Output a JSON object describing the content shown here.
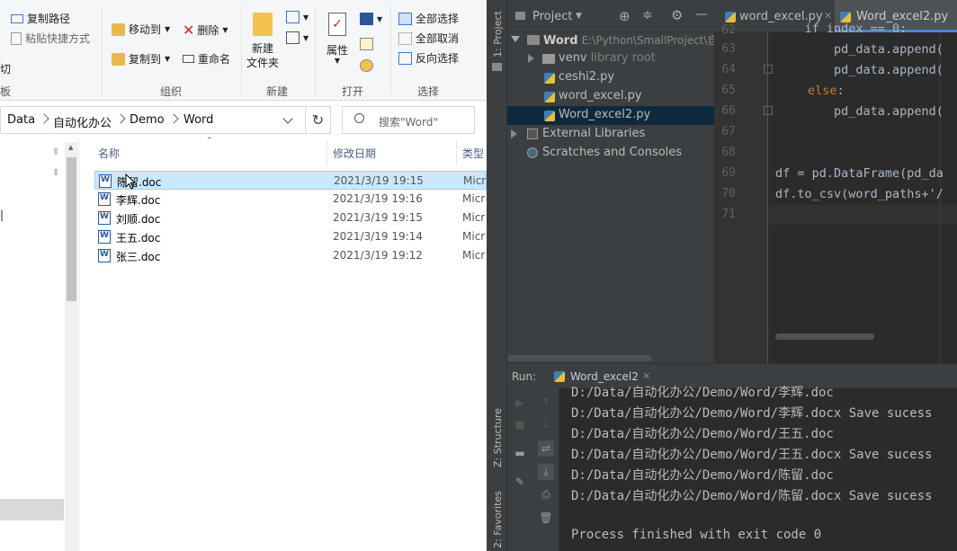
{
  "explorer": {
    "ribbon": {
      "copy_path": "复制路径",
      "paste_shortcut": "粘贴快捷方式",
      "cut_partial": "切",
      "clip_partial": "板",
      "move_to": "移动到",
      "copy_to": "复制到",
      "delete": "删除",
      "rename": "重命名",
      "new_folder": "新建\n文件夹",
      "new_folder_l1": "新建",
      "new_folder_l2": "文件夹",
      "properties": "属性",
      "select_all": "全部选择",
      "select_none": "全部取消",
      "invert_selection": "反向选择",
      "group_organize": "组织",
      "group_new": "新建",
      "group_open": "打开",
      "group_select": "选择"
    },
    "breadcrumb": [
      "Data",
      "自动化办公",
      "Demo",
      "Word"
    ],
    "search_placeholder": "搜索\"Word\"",
    "columns": {
      "name": "名称",
      "date": "修改日期",
      "type": "类型"
    },
    "files": [
      {
        "name": "陈留.doc",
        "date": "2021/3/19 19:15",
        "type": "Micr",
        "selected": true
      },
      {
        "name": "李辉.doc",
        "date": "2021/3/19 19:16",
        "type": "Micr",
        "selected": false
      },
      {
        "name": "刘顺.doc",
        "date": "2021/3/19 19:15",
        "type": "Micr",
        "selected": false
      },
      {
        "name": "王五.doc",
        "date": "2021/3/19 19:14",
        "type": "Micr",
        "selected": false
      },
      {
        "name": "张三.doc",
        "date": "2021/3/19 19:12",
        "type": "Micr",
        "selected": false
      }
    ],
    "nav_partial": "|"
  },
  "ide": {
    "side_tabs": {
      "project": "1: Project",
      "structure": "Z: Structure",
      "favorites": "2: Favorites"
    },
    "project_header": "Project",
    "tree": {
      "root_name": "Word",
      "root_path": "E:\\Python\\SmallProject\\自动",
      "venv": "venv",
      "venv_hint": "library root",
      "files": [
        "ceshi2.py",
        "word_excel.py",
        "Word_excel2.py"
      ],
      "external": "External Libraries",
      "scratches": "Scratches and Consoles"
    },
    "tabs": [
      "word_excel.py",
      "Word_excel2.py"
    ],
    "line_numbers": [
      "62",
      "63",
      "64",
      "65",
      "66",
      "67",
      "68",
      "69",
      "70",
      "71"
    ],
    "code": {
      "l62": "    if index == 0:",
      "l63": "        pd_data.append(",
      "l64": "        pd_data.append(",
      "l65_kw": "else",
      "l65_rest": ":",
      "l66": "        pd_data.append(",
      "l69": "df = pd.DataFrame(pd_da",
      "l70": "df.to_csv(word_paths+'/"
    },
    "run": {
      "label": "Run:",
      "tab": "Word_excel2",
      "output": [
        "D:/Data/自动化办公/Demo/Word/李辉.doc",
        "D:/Data/自动化办公/Demo/Word/李辉.docx Save sucess",
        "D:/Data/自动化办公/Demo/Word/王五.doc",
        "D:/Data/自动化办公/Demo/Word/王五.docx Save sucess",
        "D:/Data/自动化办公/Demo/Word/陈留.doc",
        "D:/Data/自动化办公/Demo/Word/陈留.docx Save sucess",
        "",
        "Process finished with exit code 0"
      ]
    }
  }
}
